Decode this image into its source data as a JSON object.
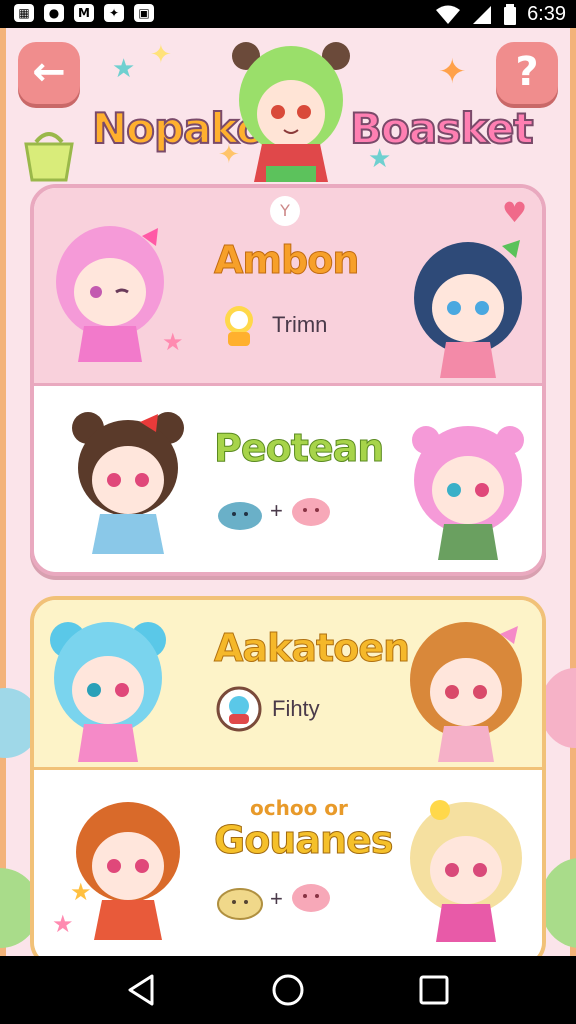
{
  "status_bar": {
    "time": "6:39",
    "left_icons": [
      "gallery-icon",
      "drop-icon",
      "mail-icon",
      "game-icon",
      "photo-icon"
    ],
    "right_icons": [
      "wifi-icon",
      "signal-icon",
      "battery-icon"
    ]
  },
  "header": {
    "back_label": "←",
    "help_label": "?",
    "title_left": "Nopako",
    "title_right": "Boasket",
    "top_badge": "Y"
  },
  "rows": [
    {
      "name": "Ambon",
      "sub": "Trimn",
      "name_color": "#f7a02a"
    },
    {
      "name": "Peotean",
      "sub": "+",
      "name_color": "#a7d44a"
    },
    {
      "name": "Aakatoen",
      "sub": "Fihty",
      "name_color": "#f5b82a"
    },
    {
      "name": "Gouanes",
      "name_top": "ochoo or",
      "sub": "+",
      "name_color": "#f5c02a"
    }
  ],
  "nav": {
    "back_icon": "nav-back-icon",
    "home_icon": "nav-home-icon",
    "recents_icon": "nav-recents-icon"
  },
  "colors": {
    "accent_pink": "#f08d8d",
    "card_pink": "#f9d1dc",
    "card_yellow": "#fdf3c8"
  }
}
